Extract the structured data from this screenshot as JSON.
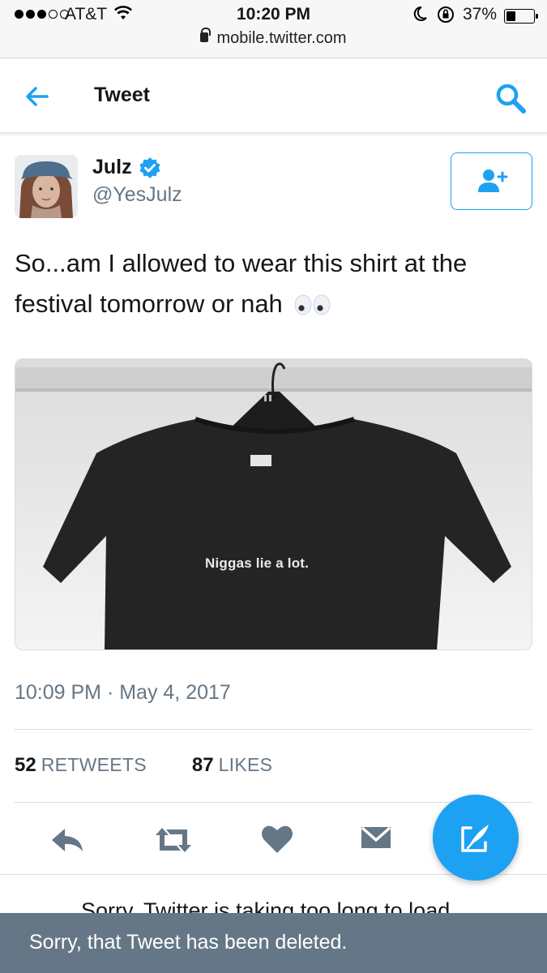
{
  "status_bar": {
    "carrier": "AT&T",
    "time": "10:20 PM",
    "battery_percent": "37%",
    "battery_level": 0.37,
    "url": "mobile.twitter.com"
  },
  "header": {
    "title": "Tweet",
    "back_icon": "arrow-left-icon",
    "search_icon": "search-icon"
  },
  "tweet": {
    "author_name": "Julz",
    "author_handle": "@YesJulz",
    "verified": true,
    "text": "So...am I allowed to wear this shirt at the festival tomorrow or nah",
    "emoji": "eyes-emoji",
    "media_shirt_text": "Niggas lie a lot.",
    "timestamp": "10:09 PM · May 4, 2017",
    "retweets_count": "52",
    "retweets_label": "RETWEETS",
    "likes_count": "87",
    "likes_label": "LIKES"
  },
  "actions": [
    "reply-icon",
    "retweet-icon",
    "like-icon",
    "direct-message-icon"
  ],
  "partial_text": "Sorry, Twitter is taking too long to load",
  "toast": {
    "message": "Sorry, that Tweet has been deleted."
  },
  "colors": {
    "twitter_blue": "#1da1f2",
    "secondary_text": "#657786",
    "action_icon": "#657786",
    "toast_bg": "#657786"
  }
}
